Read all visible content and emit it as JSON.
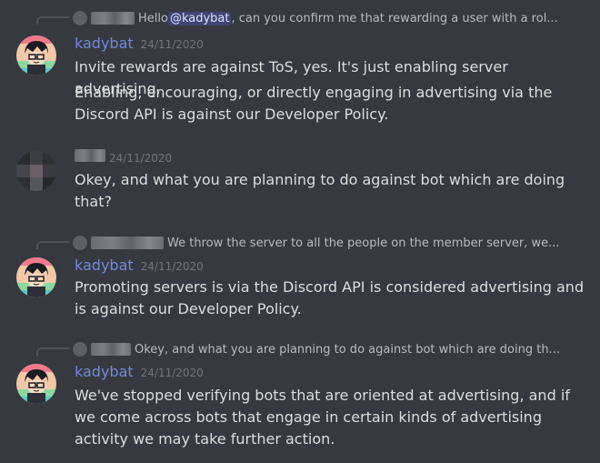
{
  "messages": [
    {
      "reply": {
        "prefix": "Hello ",
        "mention": "@kadybat",
        "suffix": ", can you confirm me that rewarding a user with a rol..."
      },
      "author": "kadybat",
      "timestamp": "24/11/2020",
      "lines": [
        "Invite rewards are against ToS, yes. It's just enabling server advertising.",
        "Enabling, encouraging, or directly engaging in advertising via the Discord API is against our Developer Policy."
      ]
    },
    {
      "author": "",
      "timestamp": "24/11/2020",
      "lines": [
        "Okey, and what you are planning to do against bot which are doing that?"
      ]
    },
    {
      "reply": {
        "text": "We throw the server to all the people on the member server, we..."
      },
      "author": "kadybat",
      "timestamp": "24/11/2020",
      "lines": [
        "Promoting servers is via the Discord API is considered advertising and is against our Developer Policy."
      ]
    },
    {
      "reply": {
        "text": "Okey, and what you are planning to do against bot which are doing th..."
      },
      "author": "kadybat",
      "timestamp": "24/11/2020",
      "lines": [
        "We've stopped verifying bots that are oriented at advertising, and if we come across bots that engage in certain kinds of advertising activity we may take further action."
      ]
    }
  ],
  "colors": {
    "background": "#36393f",
    "username": "#7289da",
    "text": "#dcddde",
    "timestamp": "#72767d",
    "mention_bg": "#414675"
  },
  "icons": {
    "kadybat_avatar": "kadybat-avatar-icon",
    "redacted_avatar": "pixelated-avatar-icon"
  }
}
